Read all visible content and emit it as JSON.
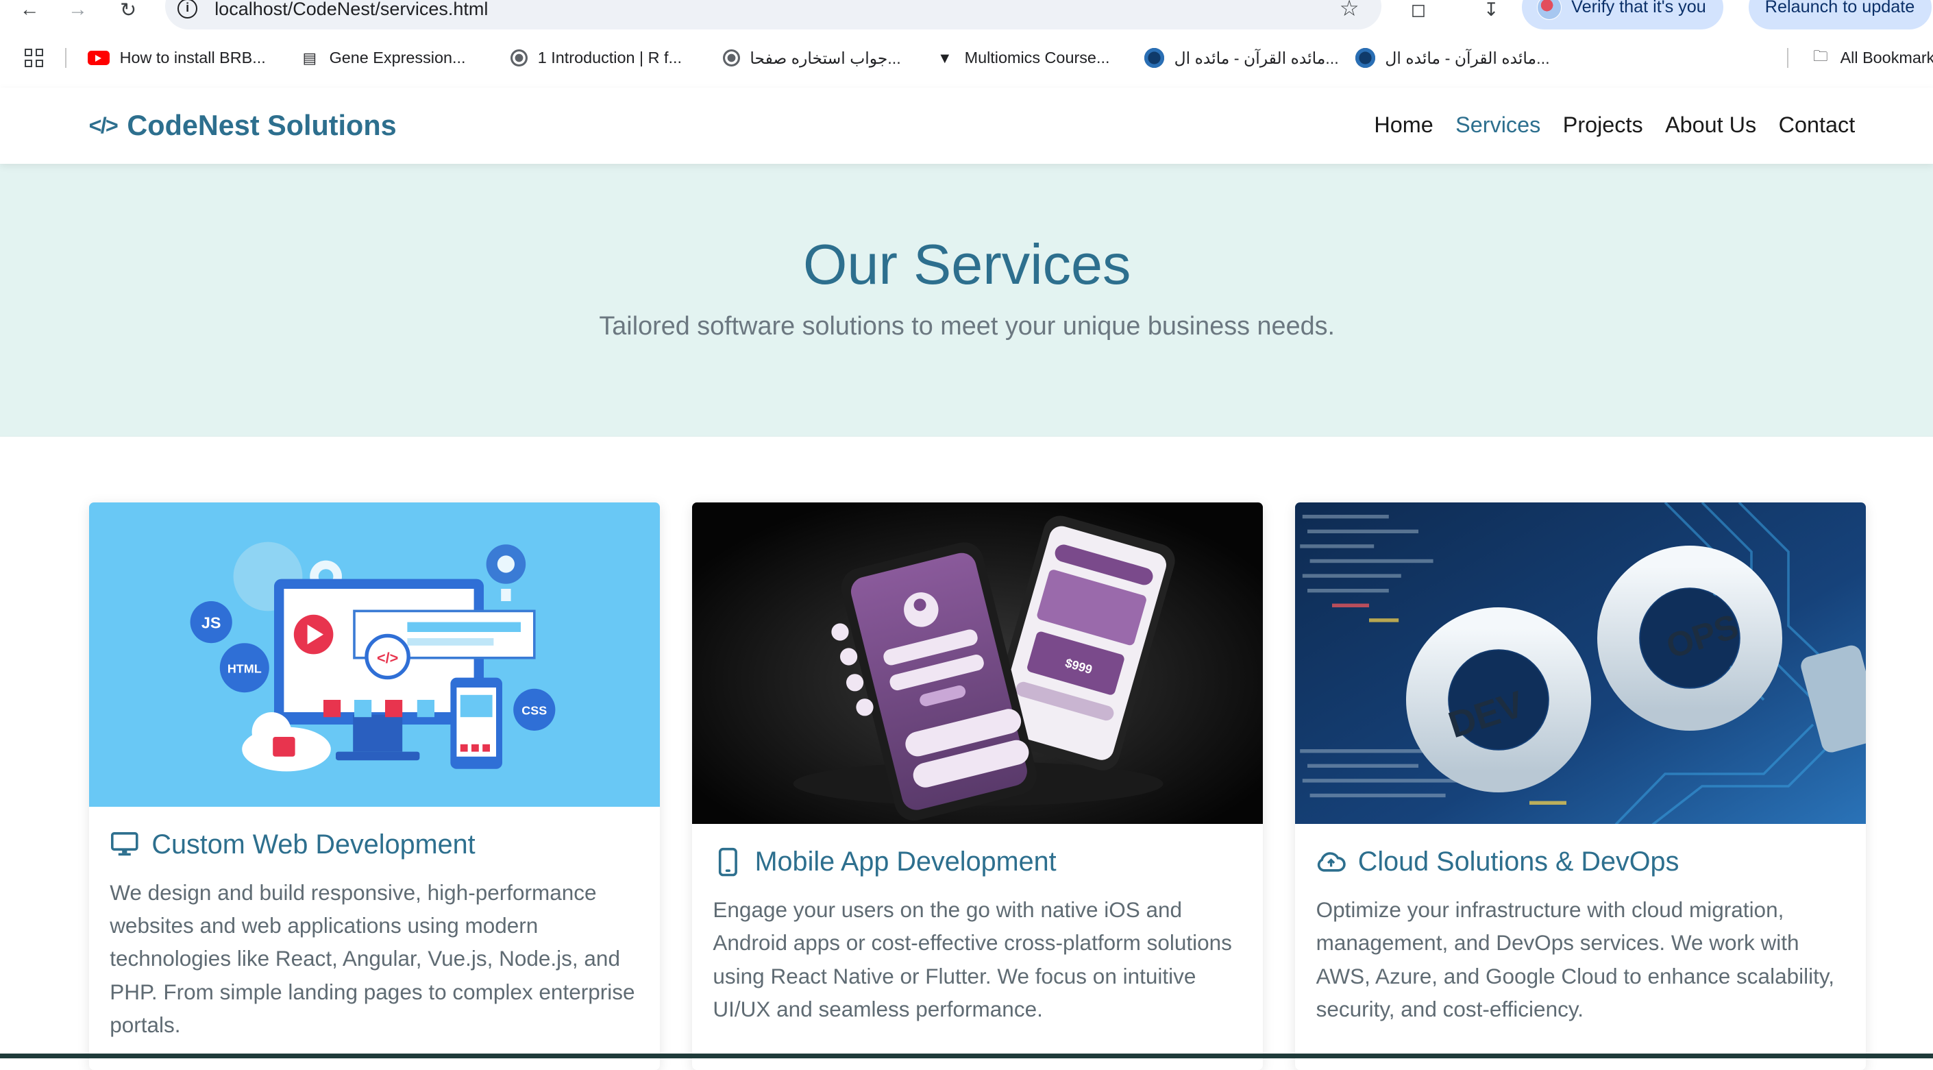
{
  "browser": {
    "url": "localhost/CodeNest/services.html",
    "profile_button": "Verify that it's you",
    "update_button": "Relaunch to update"
  },
  "bookmarks": [
    {
      "label": "How to install BRB...",
      "icon": "youtube-icon"
    },
    {
      "label": "Gene Expression...",
      "icon": "slides-icon"
    },
    {
      "label": "1 Introduction | R f...",
      "icon": "globe-icon"
    },
    {
      "label": "جواب استخاره صفحا...",
      "icon": "globe-icon"
    },
    {
      "label": "Multiomics Course...",
      "icon": "pin-icon"
    },
    {
      "label": "مائده القرآن - مائده ال...",
      "icon": "quran-icon"
    },
    {
      "label": "مائده القرآن - مائده ال...",
      "icon": "quran-icon"
    }
  ],
  "bookmarks_all": "All Bookmarks",
  "site": {
    "brand": "CodeNest Solutions",
    "brand_color": "#2d6f8e",
    "nav": [
      {
        "label": "Home",
        "active": false
      },
      {
        "label": "Services",
        "active": true
      },
      {
        "label": "Projects",
        "active": false
      },
      {
        "label": "About Us",
        "active": false
      },
      {
        "label": "Contact",
        "active": false
      }
    ]
  },
  "hero": {
    "title": "Our Services",
    "subtitle": "Tailored software solutions to meet your unique business needs.",
    "background": "#e3f3f1"
  },
  "services": [
    {
      "title": "Custom Web Development",
      "icon": "monitor-icon",
      "description": "We design and build responsive, high-performance websites and web applications using modern technologies like React, Angular, Vue.js, Node.js, and PHP. From simple landing pages to complex enterprise portals.",
      "image_labels": [
        "JS",
        "HTML",
        "CSS"
      ]
    },
    {
      "title": "Mobile App Development",
      "icon": "smartphone-icon",
      "description": "Engage your users on the go with native iOS and Android apps or cost-effective cross-platform solutions using React Native or Flutter. We focus on intuitive UI/UX and seamless performance.",
      "image_labels": [
        "$999"
      ]
    },
    {
      "title": "Cloud Solutions & DevOps",
      "icon": "cloud-upload-icon",
      "description": "Optimize your infrastructure with cloud migration, management, and DevOps services. We work with AWS, Azure, and Google Cloud to enhance scalability, security, and cost-efficiency.",
      "image_labels": [
        "DEV",
        "OPS"
      ]
    }
  ]
}
